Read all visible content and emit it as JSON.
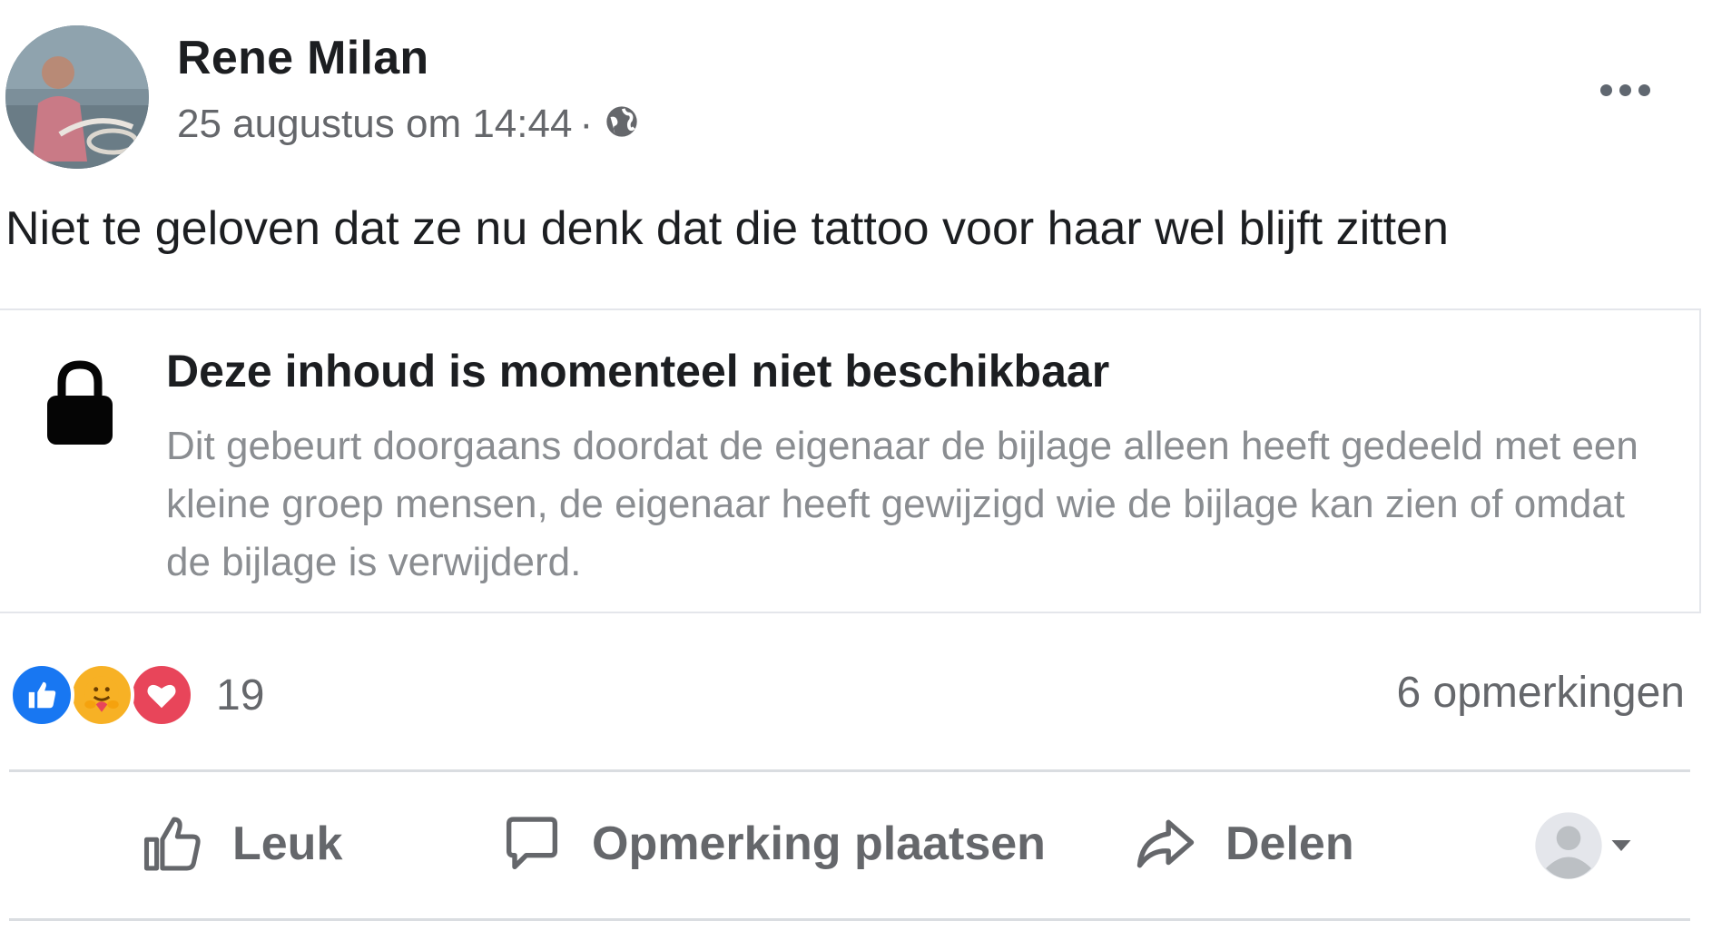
{
  "post": {
    "author": "Rene Milan",
    "timestamp": "25 augustus om 14:44",
    "separator": "·",
    "privacy_icon": "globe-icon",
    "text": "Niet te geloven dat ze nu denk dat die tattoo voor haar wel blijft zitten"
  },
  "attachment": {
    "icon": "lock-icon",
    "title": "Deze inhoud is momenteel niet beschikbaar",
    "description": "Dit gebeurt doorgaans doordat de eigenaar de bijlage alleen heeft gedeeld met een kleine groep mensen, de eigenaar heeft gewijzigd wie de bijlage kan zien of omdat de bijlage is verwijderd."
  },
  "reactions": {
    "types": [
      "like",
      "care",
      "love"
    ],
    "count": "19",
    "comments": "6 opmerkingen"
  },
  "actions": {
    "like_label": "Leuk",
    "comment_label": "Opmerking plaatsen",
    "share_label": "Delen"
  },
  "colors": {
    "like_blue": "#1877f2",
    "care_yellow": "#f7b125",
    "love_red": "#e8455a",
    "secondary_text": "#65676b"
  }
}
